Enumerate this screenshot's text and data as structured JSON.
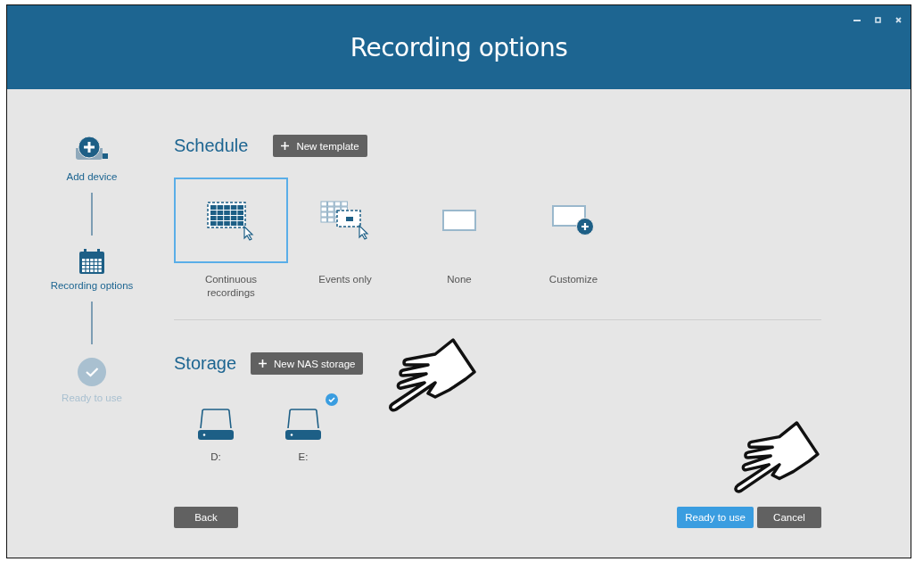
{
  "window": {
    "title": "Recording options"
  },
  "steps": [
    {
      "label": "Add device",
      "kind": "add",
      "active": true
    },
    {
      "label": "Recording options",
      "kind": "calendar",
      "active": true
    },
    {
      "label": "Ready to use",
      "kind": "check",
      "active": false
    }
  ],
  "schedule": {
    "title": "Schedule",
    "button": "New template",
    "options": [
      {
        "label": "Continuous recordings",
        "kind": "continuous",
        "selected": true
      },
      {
        "label": "Events only",
        "kind": "events",
        "selected": false
      },
      {
        "label": "None",
        "kind": "none",
        "selected": false
      },
      {
        "label": "Customize",
        "kind": "customize",
        "selected": false
      }
    ]
  },
  "storage": {
    "title": "Storage",
    "button": "New NAS storage",
    "drives": [
      {
        "label": "D:",
        "selected": false
      },
      {
        "label": "E:",
        "selected": true
      }
    ]
  },
  "buttons": {
    "back": "Back",
    "ready": "Ready to use",
    "cancel": "Cancel"
  }
}
